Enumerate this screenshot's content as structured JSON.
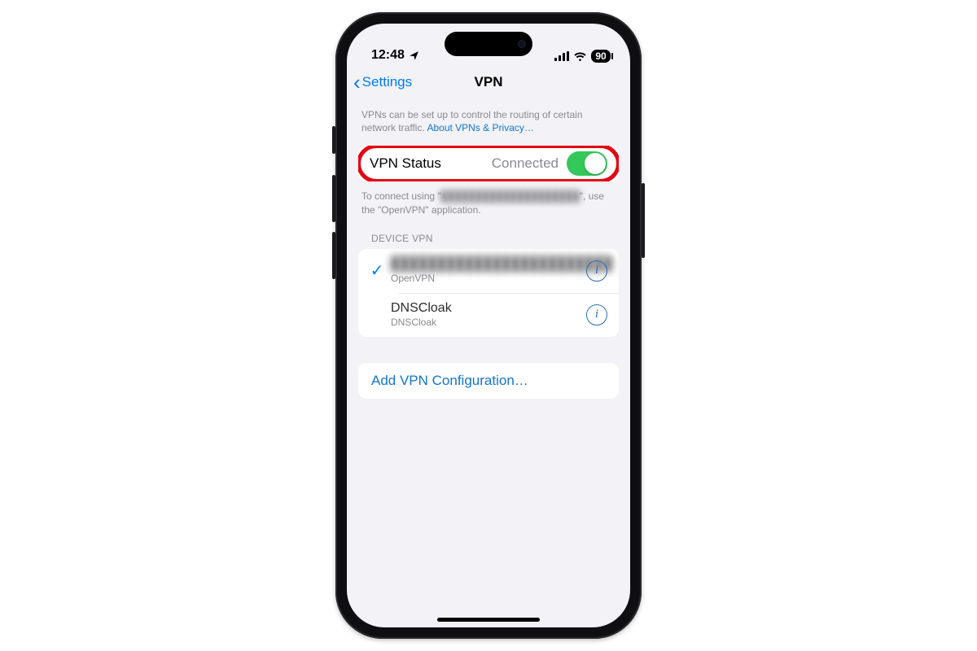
{
  "statusbar": {
    "time": "12:48",
    "battery_percent": "90"
  },
  "nav": {
    "back_label": "Settings",
    "title": "VPN"
  },
  "intro": {
    "text": "VPNs can be set up to control the routing of certain network traffic. ",
    "link": "About VPNs & Privacy…"
  },
  "vpn_status": {
    "label": "VPN Status",
    "value": "Connected",
    "on": true
  },
  "connect_hint": {
    "prefix": "To connect using \"",
    "redacted": "████████████████████",
    "suffix": "\", use the \"OpenVPN\" application."
  },
  "device_vpn_header": "DEVICE VPN",
  "profiles": [
    {
      "title": "████████████████████████",
      "redacted": true,
      "subtitle": "OpenVPN",
      "checked": true
    },
    {
      "title": "DNSCloak",
      "redacted": false,
      "subtitle": "DNSCloak",
      "checked": false
    }
  ],
  "add_link": "Add VPN Configuration…"
}
